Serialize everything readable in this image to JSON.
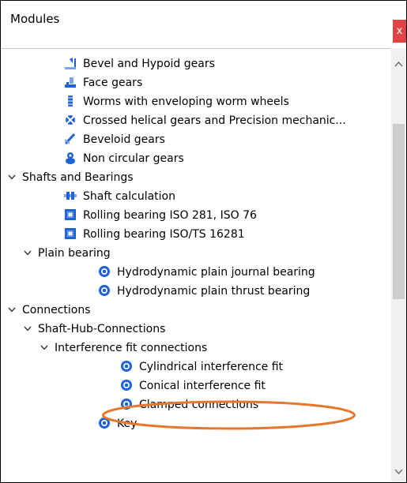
{
  "window": {
    "title": "Modules",
    "close_label": "x"
  },
  "tree": [
    {
      "label": "Bevel and Hypoid gears",
      "icon": "bevel-gear-icon",
      "level": 2
    },
    {
      "label": "Face gears",
      "icon": "face-gear-icon",
      "level": 2
    },
    {
      "label": "Worms with enveloping worm wheels",
      "icon": "worm-gear-icon",
      "level": 2
    },
    {
      "label": "Crossed helical gears and Precision mechanic...",
      "icon": "crossed-helical-gear-icon",
      "level": 2
    },
    {
      "label": "Beveloid gears",
      "icon": "beveloid-gear-icon",
      "level": 2
    },
    {
      "label": "Non circular gears",
      "icon": "non-circular-gear-icon",
      "level": 2
    },
    {
      "label": "Shafts and Bearings",
      "expand": "chevron-down-icon",
      "level": 0
    },
    {
      "label": "Shaft calculation",
      "icon": "shaft-icon",
      "level": 2
    },
    {
      "label": "Rolling bearing ISO 281, ISO 76",
      "icon": "rolling-bearing-icon",
      "level": 2
    },
    {
      "label": "Rolling bearing ISO/TS 16281",
      "icon": "rolling-bearing-icon",
      "level": 2
    },
    {
      "label": "Plain bearing",
      "expand": "chevron-down-icon",
      "level": 1
    },
    {
      "label": "Hydrodynamic plain journal bearing",
      "icon": "plain-bearing-icon",
      "level": 3
    },
    {
      "label": "Hydrodynamic plain thrust bearing",
      "icon": "plain-bearing-icon",
      "level": 3
    },
    {
      "label": "Connections",
      "expand": "chevron-down-icon",
      "level": 0
    },
    {
      "label": "Shaft-Hub-Connections",
      "expand": "chevron-down-icon",
      "level": 1
    },
    {
      "label": "Interference fit connections",
      "expand": "chevron-down-icon",
      "level": 2
    },
    {
      "label": "Cylindrical interference fit",
      "icon": "interference-fit-icon",
      "level": 4,
      "highlighted": true
    },
    {
      "label": "Conical interference fit",
      "icon": "interference-fit-icon",
      "level": 4
    },
    {
      "label": "Clamped connections",
      "icon": "interference-fit-icon",
      "level": 4
    },
    {
      "label": "Key",
      "icon": "key-connection-icon",
      "level": 3
    }
  ],
  "colors": {
    "highlight_ring": "#e8772b",
    "close_bg": "#e04343",
    "icon_blue": "#1f62d6"
  }
}
